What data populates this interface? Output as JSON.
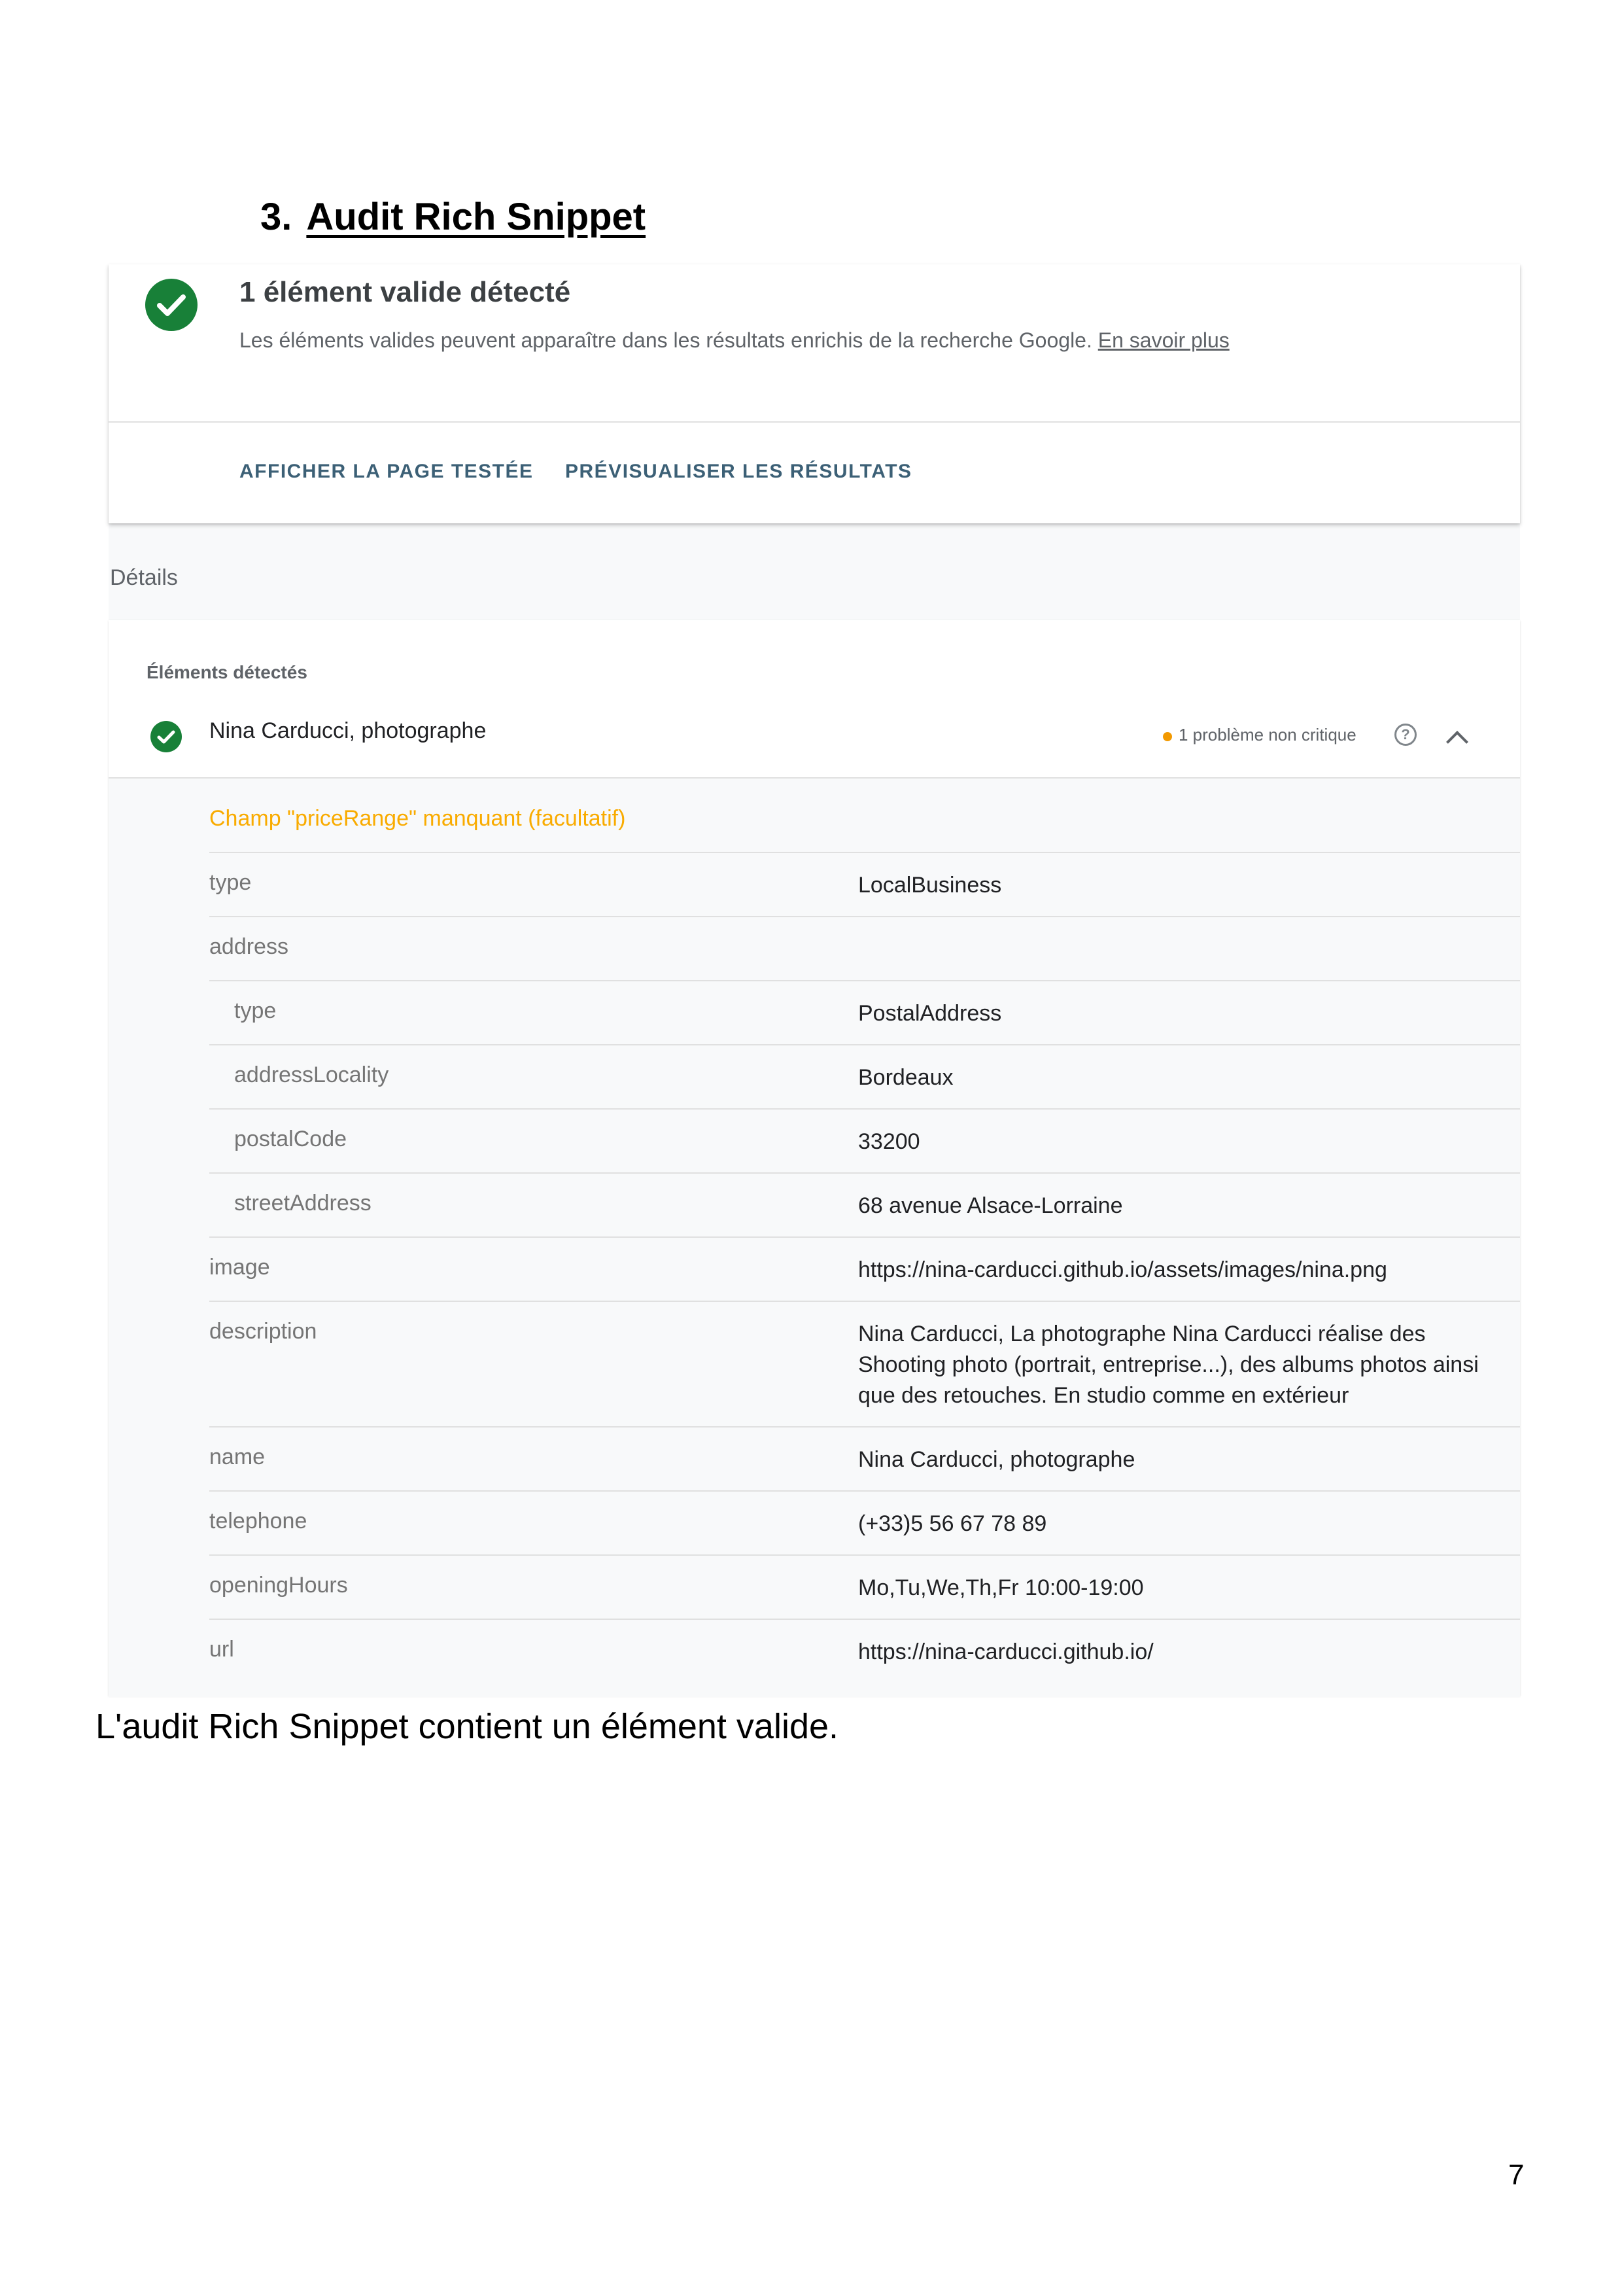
{
  "heading": {
    "number": "3.",
    "title": "Audit Rich Snippet"
  },
  "summary_card": {
    "title": "1 élément valide détecté",
    "description": "Les éléments valides peuvent apparaître dans les résultats enrichis de la recherche Google.",
    "learn_more": "En savoir plus",
    "actions": {
      "view_page": "AFFICHER LA PAGE TESTÉE",
      "preview": "PRÉVISUALISER LES RÉSULTATS"
    }
  },
  "details_label": "Détails",
  "detected": {
    "label": "Éléments détectés",
    "item_name": "Nina Carducci, photographe",
    "issue_text": "1 problème non critique",
    "warning": "Champ \"priceRange\" manquant (facultatif)",
    "fields": [
      {
        "key": "type",
        "value": "LocalBusiness"
      },
      {
        "key": "address",
        "value": ""
      },
      {
        "key": "type",
        "value": "PostalAddress"
      },
      {
        "key": "addressLocality",
        "value": "Bordeaux"
      },
      {
        "key": "postalCode",
        "value": "33200"
      },
      {
        "key": "streetAddress",
        "value": "68 avenue Alsace-Lorraine"
      },
      {
        "key": "image",
        "value": "https://nina-carducci.github.io/assets/images/nina.png"
      },
      {
        "key": "description",
        "value": "Nina Carducci, La photographe Nina Carducci réalise des Shooting photo (portrait, entreprise...), des albums photos ainsi que des retouches. En studio comme en extérieur"
      },
      {
        "key": "name",
        "value": "Nina Carducci, photographe"
      },
      {
        "key": "telephone",
        "value": "(+33)5 56 67 78 89"
      },
      {
        "key": "openingHours",
        "value": "Mo,Tu,We,Th,Fr 10:00-19:00"
      },
      {
        "key": "url",
        "value": "https://nina-carducci.github.io/"
      }
    ]
  },
  "caption": "L'audit Rich Snippet contient un élément valide.",
  "page_number": "7",
  "colors": {
    "valid": "#188038",
    "warning": "#f9ab00",
    "link": "#3c6076"
  },
  "icons": {
    "valid": "check-circle-icon",
    "help": "help-circle-icon",
    "collapse": "chevron-up-icon"
  }
}
